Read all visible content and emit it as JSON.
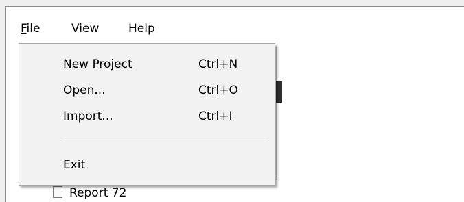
{
  "menubar": {
    "items": [
      {
        "label": "File",
        "mnemonic": "F",
        "rest": "ile"
      },
      {
        "label": "View"
      },
      {
        "label": "Help"
      }
    ]
  },
  "file_menu": {
    "items": [
      {
        "label": "New Project",
        "shortcut": "Ctrl+N"
      },
      {
        "label": "Open...",
        "shortcut": "Ctrl+O"
      },
      {
        "label": "Import...",
        "shortcut": "Ctrl+I"
      },
      {
        "label": "Exit",
        "shortcut": ""
      }
    ]
  },
  "background": {
    "list_item_label": "Report 72"
  },
  "colors": {
    "menu_background": "#f2f2f2",
    "window_background": "#ffffff",
    "separator": "#c8c8c8"
  }
}
